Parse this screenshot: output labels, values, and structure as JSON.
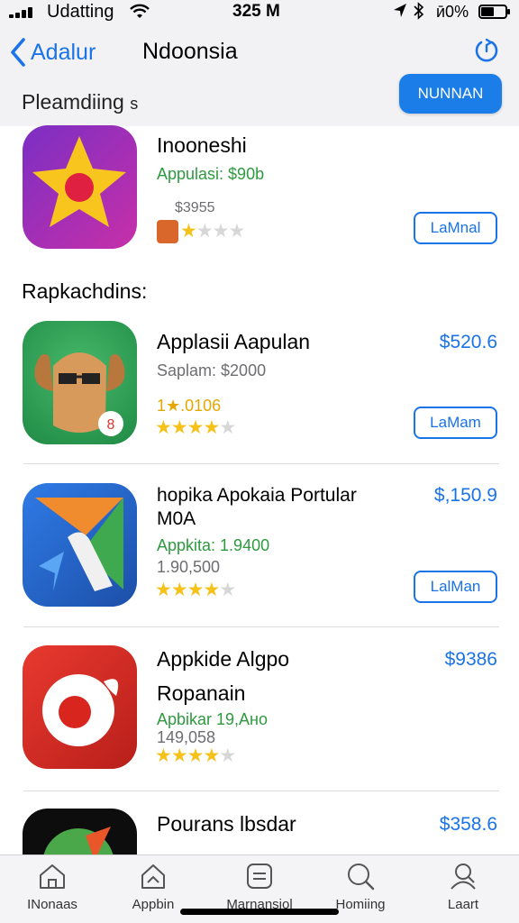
{
  "status_bar": {
    "carrier": "Udatting",
    "time": "325 M",
    "battery": "ӣ0%",
    "icons": [
      "signal-icon",
      "wifi-icon",
      "location-icon",
      "bluetooth-icon",
      "battery-icon"
    ]
  },
  "nav": {
    "back_label": "Adalur",
    "title": "Ndoonsia",
    "section_title": "Pleamdiing",
    "section_suffix": "s",
    "primary_button": "NUNNAN"
  },
  "featured": {
    "name": "Inooneshi",
    "subtitle": "Appulasi: $90b",
    "price_line": "$3955",
    "rating": 1,
    "rating_max": 4,
    "get_label": "LaMnal"
  },
  "heading2": "Rapkachdins:",
  "apps": [
    {
      "name_lines": [
        "Applasii Aapulan"
      ],
      "subtitle": "Saplam: $2000",
      "meta": "1★.0106",
      "rating": 4,
      "price": "$520.6",
      "get_label": "LaMam"
    },
    {
      "name_lines": [
        "hopika Apokaia Portular",
        "M0A"
      ],
      "subtitle": "Appkita: 1.9400",
      "meta": "1.90,500",
      "rating": 4,
      "price": "$,150.9",
      "get_label": "LalMan"
    },
    {
      "name_lines": [
        "Appkide Algpo",
        "Ropanain"
      ],
      "subtitle": "Apbikar 19,Ано",
      "meta": "149,058",
      "rating": 4,
      "price": "$9386",
      "get_label": ""
    },
    {
      "name_lines": [
        "Pourans lbsdar"
      ],
      "subtitle": "",
      "meta": "",
      "rating": 0,
      "price": "$358.6",
      "get_label": ""
    }
  ],
  "tabs": [
    {
      "label": "INonaas",
      "icon": "home-icon"
    },
    {
      "label": "Appbin",
      "icon": "apps-icon"
    },
    {
      "label": "Marnansiol",
      "icon": "list-icon"
    },
    {
      "label": "Homiing",
      "icon": "search-icon"
    },
    {
      "label": "Laart",
      "icon": "account-icon"
    }
  ],
  "colors": {
    "accent": "#1a73e8",
    "button_fill": "#1a7de8",
    "star": "#f5c21b",
    "green_text": "#2e9a3f"
  }
}
